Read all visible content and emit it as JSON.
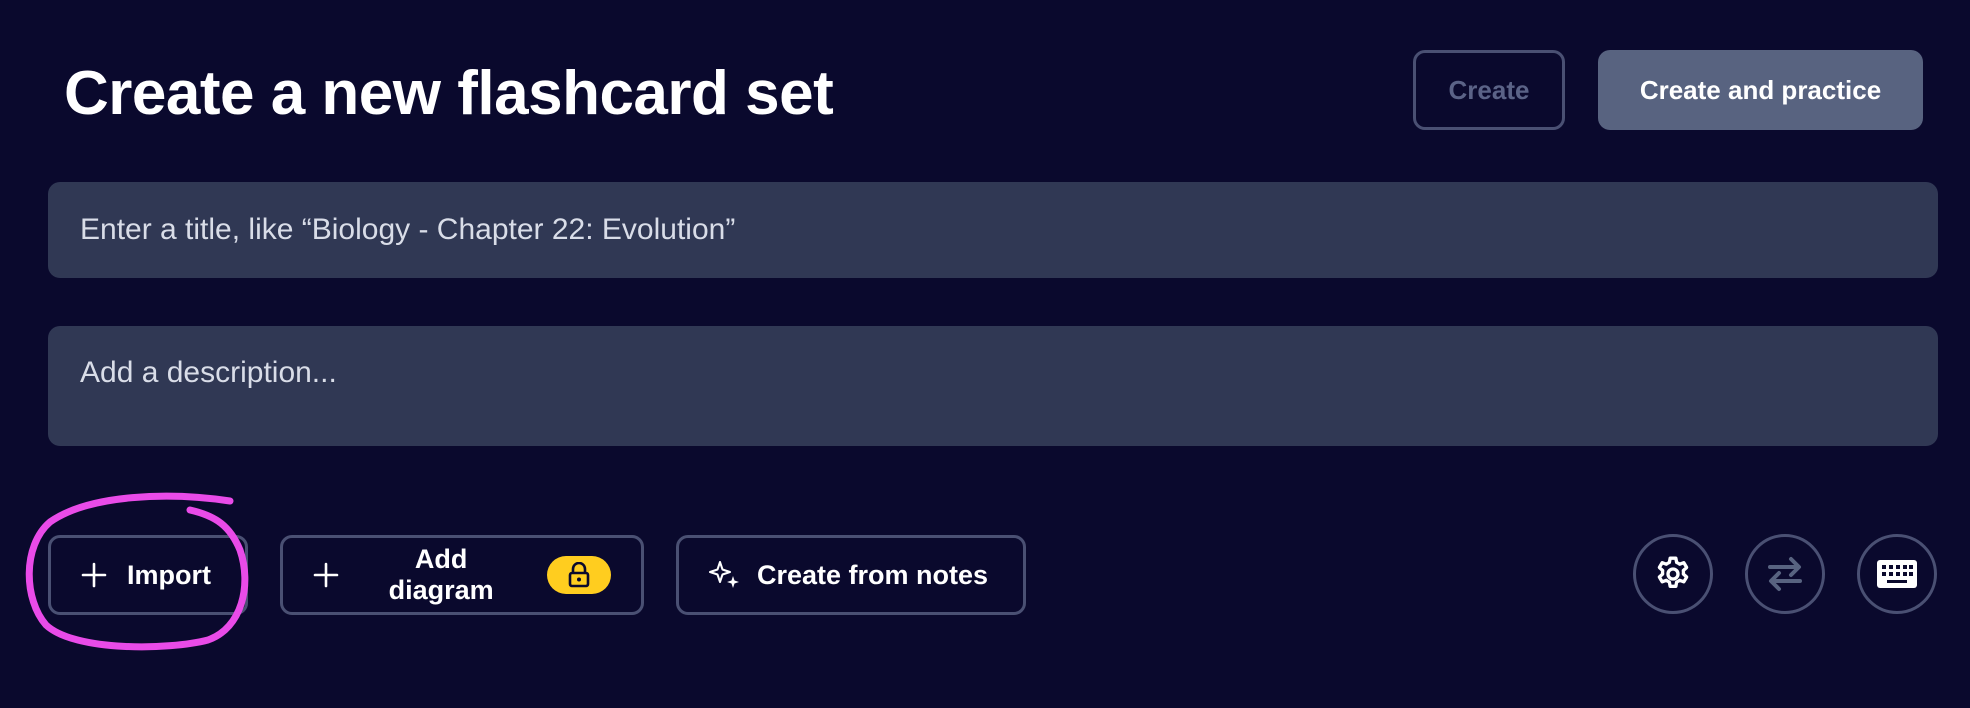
{
  "header": {
    "title": "Create a new flashcard set",
    "create_label": "Create",
    "create_practice_label": "Create and practice"
  },
  "form": {
    "title_placeholder": "Enter a title, like “Biology - Chapter 22: Evolution”",
    "description_placeholder": "Add a description..."
  },
  "toolbar": {
    "import_label": "Import",
    "add_diagram_label": "Add diagram",
    "create_from_notes_label": "Create from notes",
    "icons": {
      "import": "plus-icon",
      "add_diagram": "plus-icon",
      "add_diagram_badge": "lock-icon",
      "create_from_notes": "sparkles-icon",
      "settings": "gear-icon",
      "swap": "swap-arrows-icon",
      "keyboard": "keyboard-icon"
    }
  },
  "colors": {
    "background": "#0a092d",
    "field_background": "#303854",
    "border": "#4a5073",
    "primary_button": "#586380",
    "lock_badge": "#ffcd1f",
    "annotation": "#e94be8"
  }
}
